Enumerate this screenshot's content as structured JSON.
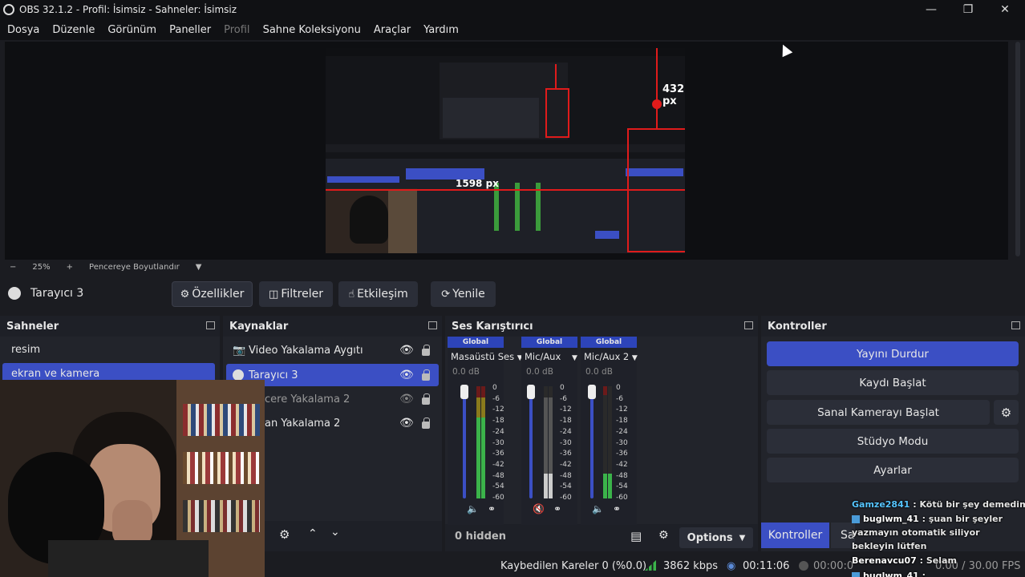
{
  "window": {
    "title": "OBS 32.1.2 - Profil: İsimsiz - Sahneler: İsimsiz"
  },
  "menu": [
    "Dosya",
    "Düzenle",
    "Görünüm",
    "Paneller",
    "Profil",
    "Sahne Koleksiyonu",
    "Araçlar",
    "Yardım"
  ],
  "preview": {
    "measure_h": "432 px",
    "measure_w": "1598 px",
    "zoom": "25%",
    "resize_label": "Pencereye Boyutlandır"
  },
  "context": {
    "source_name": "Tarayıcı 3",
    "btn_properties": "Özellikler",
    "btn_filters": "Filtreler",
    "btn_interact": "Etkileşim",
    "btn_refresh": "Yenile"
  },
  "scenes": {
    "title": "Sahneler",
    "items": [
      "resim",
      "ekran ve kamera"
    ]
  },
  "sources": {
    "title": "Kaynaklar",
    "items": [
      "Video Yakalama Aygıtı",
      "Tarayıcı 3",
      "cere Yakalama 2",
      "an Yakalama 2"
    ]
  },
  "mixer": {
    "title": "Ses Karıştırıcı",
    "channels": [
      {
        "head": "Global",
        "name": "Masaüstü Ses",
        "db": "0.0 dB"
      },
      {
        "head": "Global",
        "name": "Mic/Aux",
        "db": "0.0 dB"
      },
      {
        "head": "Global",
        "name": "Mic/Aux 2",
        "db": "0.0 dB"
      }
    ],
    "ticks": [
      "0",
      "-6",
      "-12",
      "-18",
      "-24",
      "-30",
      "-36",
      "-42",
      "-48",
      "-54",
      "-60"
    ],
    "hidden": "0 hidden",
    "options": "Options"
  },
  "controls": {
    "title": "Kontroller",
    "stop_stream": "Yayını Durdur",
    "start_record": "Kaydı Başlat",
    "virtual_cam": "Sanal Kamerayı Başlat",
    "studio_mode": "Stüdyo Modu",
    "settings": "Ayarlar",
    "tab_controls": "Kontroller",
    "tab_partial": "Sa"
  },
  "status": {
    "dropped": "Kaybedilen Kareler 0 (%0.0)",
    "bitrate": "3862 kbps",
    "stream_time": "00:11:06",
    "record_time": "00:00:0",
    "fps": "0.00 / 30.00 FPS"
  },
  "chat": [
    {
      "user": "Gamze2841",
      "msg": " : Kötü bir şey demedim"
    },
    {
      "user": "buglwm_41",
      "msg": " : şuan bir şeyler yazmayın otomatik siliyor bekleyin lütfen"
    },
    {
      "user": "Berenavcu07",
      "msg": " : Selam"
    },
    {
      "user": "buglwm_41",
      "msg": " :"
    }
  ],
  "colors": {
    "accent": "#3b4fc4",
    "bg": "#1b1c21",
    "panel": "#22242b",
    "measure_red": "#e01b1b"
  }
}
